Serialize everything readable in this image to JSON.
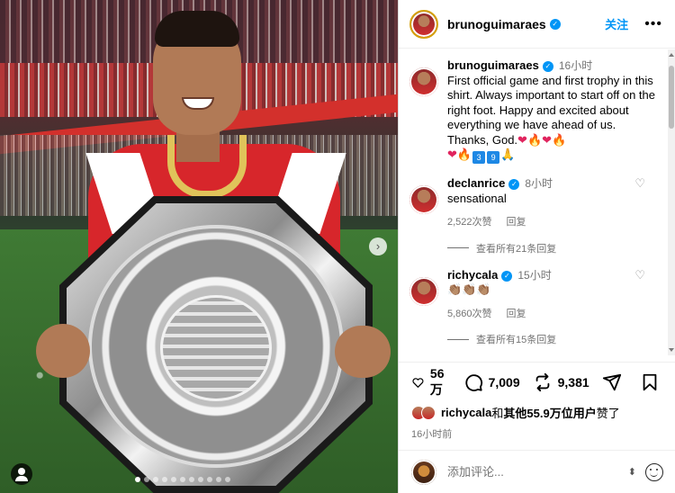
{
  "post": {
    "author": "brunoguimaraes",
    "follow_label": "关注",
    "more_label": "•••",
    "photo_alt": "Player smiling holding a silver shield trophy in a red and white shirt",
    "nav_next": "›",
    "carousel_total": 11,
    "carousel_active": 1
  },
  "caption": {
    "author": "brunoguimaraes",
    "time": "16小时",
    "text": "First official game and first trophy in this shirt. Always important to start off on the right foot. Happy and excited about everything we have ahead of us. Thanks, God.",
    "emoji_line1": [
      "❤",
      "🔥",
      "❤",
      "🔥"
    ],
    "emoji_line2": [
      "❤",
      "🔥",
      "3",
      "9",
      "🙏"
    ]
  },
  "comments": [
    {
      "author": "declanrice",
      "time": "8小时",
      "text": "sensational",
      "likes": "2,522次赞",
      "reply_label": "回复",
      "view_replies": "查看所有21条回复"
    },
    {
      "author": "richycala",
      "time": "15小时",
      "text": "👏🏽👏🏽👏🏽",
      "likes": "5,860次赞",
      "reply_label": "回复",
      "view_replies": "查看所有15条回复"
    }
  ],
  "actions": {
    "likes": "56 万",
    "comments": "7,009",
    "shares": "9,381"
  },
  "liked_by": {
    "user": "richycala",
    "text": "和",
    "others": "其他55.9万位用户",
    "suffix": "赞了"
  },
  "post_time": "16小时前",
  "comment_input": {
    "placeholder": "添加评论..."
  },
  "colors": {
    "accent": "#0095f6",
    "heart": "#e0245e",
    "muted": "#737373"
  },
  "icons": [
    "verified-icon",
    "heart-icon",
    "comment-icon",
    "share-icon",
    "send-icon",
    "bookmark-icon",
    "emoji-icon",
    "sort-icon",
    "user-tag-icon"
  ]
}
